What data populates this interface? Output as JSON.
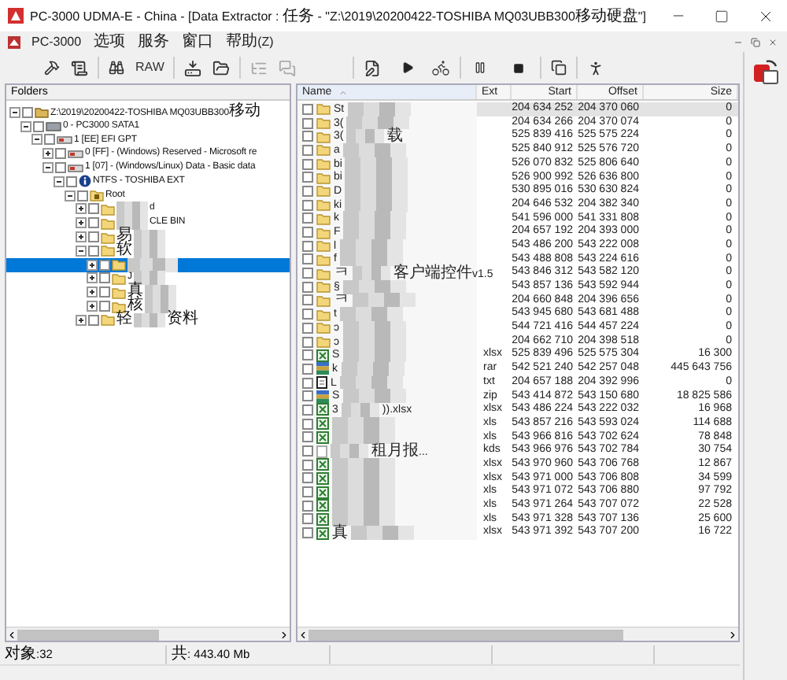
{
  "window": {
    "title": "PC-3000 UDMA-E - China - [Data Extractor : 任务 - \"Z:\\2019\\20200422-TOSHIBA MQ03UBB300移动硬盘\"]"
  },
  "menu": [
    {
      "label": "PC-3000"
    },
    {
      "label": "选项"
    },
    {
      "label": "服务"
    },
    {
      "label": "窗口"
    },
    {
      "label": "帮助(Z)"
    }
  ],
  "toolbar": {
    "raw_label": "RAW"
  },
  "folders": {
    "title": "Folders",
    "tree": [
      {
        "kind": "disk",
        "label": "Z:\\2019\\20200422-TOSHIBA MQ03UBB300移动",
        "checked": false,
        "expanded": true,
        "selected": false,
        "children": [
          {
            "kind": "drive",
            "label": "0 - PC3000 SATA1",
            "checked": false,
            "expanded": true,
            "selected": false,
            "children": [
              {
                "kind": "partition",
                "label": "1 [EE] EFI GPT",
                "checked": false,
                "expanded": true,
                "selected": false,
                "children": [
                  {
                    "kind": "partition",
                    "label": "0 [FF] - (Windows) Reserved - Microsoft re",
                    "checked": false,
                    "expanded": false,
                    "selected": false
                  },
                  {
                    "kind": "partition",
                    "label": "1 [07] - (Windows/Linux) Data - Basic data",
                    "checked": false,
                    "expanded": true,
                    "selected": false,
                    "children": [
                      {
                        "kind": "volume",
                        "label": "NTFS - TOSHIBA EXT",
                        "checked": false,
                        "expanded": true,
                        "selected": false,
                        "children": [
                          {
                            "kind": "root",
                            "label": "Root",
                            "checked": false,
                            "expanded": true,
                            "selected": false,
                            "children": [
                              {
                                "kind": "folder",
                                "tail": "d",
                                "redacted": true,
                                "checked": false,
                                "expanded": false,
                                "selected": false
                              },
                              {
                                "kind": "folder",
                                "tail": "CLE BIN",
                                "redacted": true,
                                "checked": false,
                                "expanded": false,
                                "selected": false
                              },
                              {
                                "kind": "folder",
                                "label": "易",
                                "redacted": true,
                                "checked": false,
                                "expanded": false,
                                "selected": false
                              },
                              {
                                "kind": "folder",
                                "label": "软",
                                "redacted": true,
                                "checked": false,
                                "expanded": true,
                                "selected": false,
                                "children": [
                                  {
                                    "kind": "folder",
                                    "redacted": true,
                                    "checked": false,
                                    "expanded": false,
                                    "selected": true
                                  },
                                  {
                                    "kind": "folder",
                                    "label": "J",
                                    "redacted": true,
                                    "checked": false,
                                    "expanded": false,
                                    "selected": false
                                  },
                                  {
                                    "kind": "folder",
                                    "label": "真",
                                    "redacted": true,
                                    "checked": false,
                                    "expanded": false,
                                    "selected": false
                                  },
                                  {
                                    "kind": "folder",
                                    "label": "核",
                                    "redacted": true,
                                    "checked": false,
                                    "expanded": false,
                                    "selected": false
                                  }
                                ]
                              },
                              {
                                "kind": "folder",
                                "label": "轻",
                                "tail": "资料",
                                "redacted": true,
                                "checked": false,
                                "expanded": false,
                                "selected": false
                              }
                            ]
                          }
                        ]
                      }
                    ]
                  }
                ]
              }
            ]
          }
        ]
      }
    ]
  },
  "files": {
    "columns": [
      {
        "label": "Name",
        "sorted": true
      },
      {
        "label": "Ext",
        "sorted": false
      },
      {
        "label": "Start",
        "sorted": false
      },
      {
        "label": "Offset",
        "sorted": false
      },
      {
        "label": "Size",
        "sorted": false
      }
    ],
    "rows": [
      {
        "kind": "folder",
        "name": "St",
        "redacted": true,
        "start": "204 634 252",
        "offset": "204 370 060",
        "size": "0",
        "checked": false,
        "selected": true
      },
      {
        "kind": "folder",
        "name": "3(",
        "redacted": true,
        "start": "204 634 266",
        "offset": "204 370 074",
        "size": "0",
        "checked": false,
        "selected": false
      },
      {
        "kind": "folder",
        "name": "3(",
        "tail": "载",
        "redacted": true,
        "start": "525 839 416",
        "offset": "525 575 224",
        "size": "0",
        "checked": false,
        "selected": false
      },
      {
        "kind": "folder",
        "name": "a",
        "redacted": true,
        "start": "525 840 912",
        "offset": "525 576 720",
        "size": "0",
        "checked": false,
        "selected": false
      },
      {
        "kind": "folder",
        "name": "bi",
        "redacted": true,
        "start": "526 070 832",
        "offset": "525 806 640",
        "size": "0",
        "checked": false,
        "selected": false
      },
      {
        "kind": "folder",
        "name": "bi",
        "redacted": true,
        "start": "526 900 992",
        "offset": "526 636 800",
        "size": "0",
        "checked": false,
        "selected": false
      },
      {
        "kind": "folder",
        "name": "D",
        "redacted": true,
        "start": "530 895 016",
        "offset": "530 630 824",
        "size": "0",
        "checked": false,
        "selected": false
      },
      {
        "kind": "folder",
        "name": "ki",
        "redacted": true,
        "start": "204 646 532",
        "offset": "204 382 340",
        "size": "0",
        "checked": false,
        "selected": false
      },
      {
        "kind": "folder",
        "name": "k",
        "redacted": true,
        "start": "541 596 000",
        "offset": "541 331 808",
        "size": "0",
        "checked": false,
        "selected": false
      },
      {
        "kind": "folder",
        "name": "F",
        "redacted": true,
        "start": "204 657 192",
        "offset": "204 393 000",
        "size": "0",
        "checked": false,
        "selected": false
      },
      {
        "kind": "folder",
        "name": "l",
        "redacted": true,
        "start": "543 486 200",
        "offset": "543 222 008",
        "size": "0",
        "checked": false,
        "selected": false
      },
      {
        "kind": "folder",
        "name": "f",
        "redacted": true,
        "start": "543 488 808",
        "offset": "543 224 616",
        "size": "0",
        "checked": false,
        "selected": false
      },
      {
        "kind": "folder",
        "name": "ㅋ",
        "tail": "客户端控件v1.5",
        "redacted": true,
        "start": "543 846 312",
        "offset": "543 582 120",
        "size": "0",
        "checked": false,
        "selected": false
      },
      {
        "kind": "folder",
        "name": "§",
        "redacted": true,
        "start": "543 857 136",
        "offset": "543 592 944",
        "size": "0",
        "checked": false,
        "selected": false
      },
      {
        "kind": "folder",
        "name": "ㅋ",
        "redacted": true,
        "start": "204 660 848",
        "offset": "204 396 656",
        "size": "0",
        "checked": false,
        "selected": false
      },
      {
        "kind": "folder",
        "name": "t",
        "redacted": true,
        "start": "543 945 680",
        "offset": "543 681 488",
        "size": "0",
        "checked": false,
        "selected": false
      },
      {
        "kind": "folder",
        "name": "ɔ",
        "redacted": true,
        "start": "544 721 416",
        "offset": "544 457 224",
        "size": "0",
        "checked": false,
        "selected": false
      },
      {
        "kind": "folder",
        "name": "ɔ",
        "redacted": true,
        "start": "204 662 710",
        "offset": "204 398 518",
        "size": "0",
        "checked": false,
        "selected": false
      },
      {
        "kind": "excel",
        "name": "S",
        "redacted": true,
        "ext": "xlsx",
        "start": "525 839 496",
        "offset": "525 575 304",
        "size": "16 300",
        "checked": false,
        "selected": false
      },
      {
        "kind": "archive",
        "name": "k",
        "redacted": true,
        "ext": "rar",
        "start": "542 521 240",
        "offset": "542 257 048",
        "size": "445 643 756",
        "checked": false,
        "selected": false
      },
      {
        "kind": "text",
        "name": "L",
        "redacted": true,
        "ext": "txt",
        "start": "204 657 188",
        "offset": "204 392 996",
        "size": "0",
        "checked": false,
        "selected": false
      },
      {
        "kind": "archive",
        "name": "S",
        "redacted": true,
        "ext": "zip",
        "start": "543 414 872",
        "offset": "543 150 680",
        "size": "18 825 586",
        "checked": false,
        "selected": false
      },
      {
        "kind": "excel",
        "name": "3",
        "tail": ")).xlsx",
        "redacted": true,
        "ext": "xlsx",
        "start": "543 486 224",
        "offset": "543 222 032",
        "size": "16 968",
        "checked": false,
        "selected": false
      },
      {
        "kind": "excel",
        "redacted": true,
        "ext": "xls",
        "start": "543 857 216",
        "offset": "543 593 024",
        "size": "114 688",
        "checked": false,
        "selected": false
      },
      {
        "kind": "excel",
        "redacted": true,
        "ext": "xls",
        "start": "543 966 816",
        "offset": "543 702 624",
        "size": "78 848",
        "checked": false,
        "selected": false
      },
      {
        "kind": "blank",
        "tail": "租月报...",
        "redacted": true,
        "ext": "kds",
        "start": "543 966 976",
        "offset": "543 702 784",
        "size": "30 754",
        "checked": false,
        "selected": false
      },
      {
        "kind": "excel",
        "redacted": true,
        "ext": "xlsx",
        "start": "543 970 960",
        "offset": "543 706 768",
        "size": "12 867",
        "checked": false,
        "selected": false
      },
      {
        "kind": "excel",
        "redacted": true,
        "ext": "xlsx",
        "start": "543 971 000",
        "offset": "543 706 808",
        "size": "34 599",
        "checked": false,
        "selected": false
      },
      {
        "kind": "excel",
        "redacted": true,
        "ext": "xls",
        "start": "543 971 072",
        "offset": "543 706 880",
        "size": "97 792",
        "checked": false,
        "selected": false
      },
      {
        "kind": "excel",
        "redacted": true,
        "ext": "xls",
        "start": "543 971 264",
        "offset": "543 707 072",
        "size": "22 528",
        "checked": false,
        "selected": false
      },
      {
        "kind": "excel",
        "redacted": true,
        "ext": "xls",
        "start": "543 971 328",
        "offset": "543 707 136",
        "size": "25 600",
        "checked": false,
        "selected": false
      },
      {
        "kind": "excel",
        "name": "真",
        "redacted": true,
        "ext": "xlsx",
        "start": "543 971 392",
        "offset": "543 707 200",
        "size": "16 722",
        "checked": false,
        "selected": false
      }
    ]
  },
  "status_bar": [
    {
      "text": "对象:32"
    },
    {
      "text": "共: 443.40 Mb"
    }
  ]
}
